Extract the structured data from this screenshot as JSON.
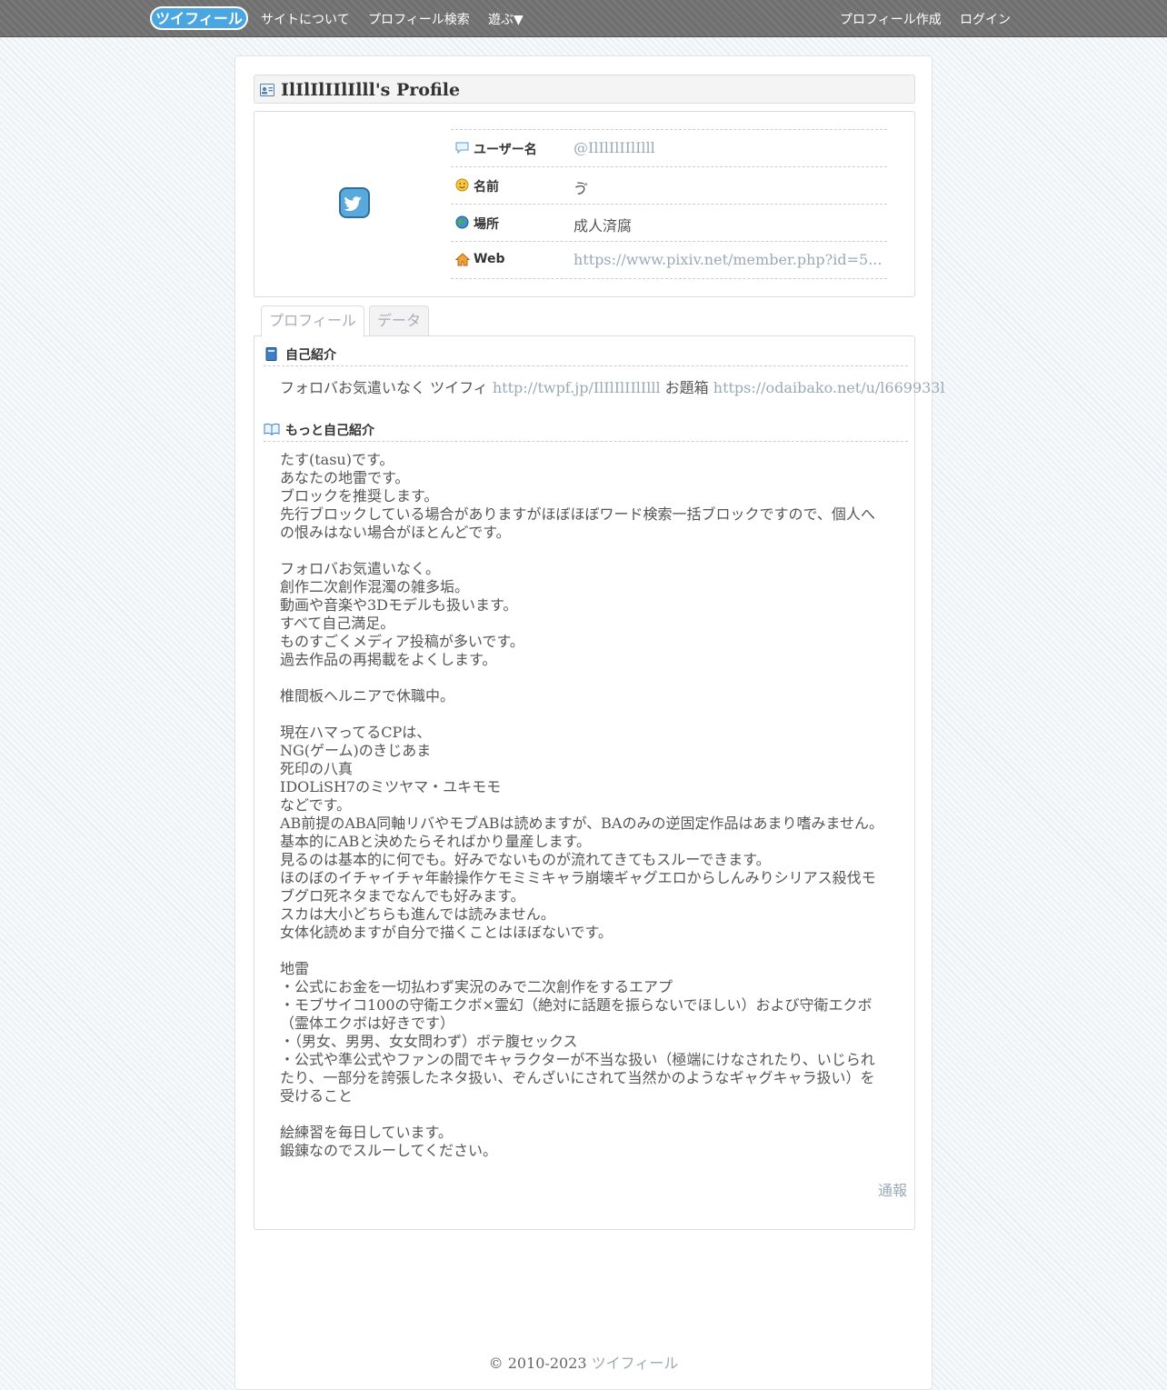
{
  "nav": {
    "logo_text": "ツイフィール",
    "about": "サイトについて",
    "search": "プロフィール検索",
    "play": "遊ぶ▼",
    "create": "プロフィール作成",
    "login": "ログイン"
  },
  "profile": {
    "title": "IlIlIlIIlIlll's Profile",
    "rows": [
      {
        "label": "ユーザー名",
        "value": "@IlIlIlIIlIlll",
        "icon": "speech-bubble-icon"
      },
      {
        "label": "名前",
        "value": "ゔ",
        "icon": "smiley-icon"
      },
      {
        "label": "場所",
        "value": "成人済腐",
        "icon": "globe-icon"
      },
      {
        "label": "Web",
        "value": "https://www.pixiv.net/member.php?id=5...",
        "icon": "home-icon"
      }
    ]
  },
  "tabs": {
    "profile": "プロフィール",
    "data": "データ"
  },
  "intro": {
    "heading": "自己紹介",
    "text1": "フォロバお気遣いなく ツイフィ ",
    "link1": "http://twpf.jp/IlIlIlIIlIlll",
    "text2": " お題箱 ",
    "link2": "https://odaibako.net/u/l669933l"
  },
  "more": {
    "heading": "もっと自己紹介",
    "lines": [
      "たす(tasu)です。",
      "あなたの地雷です。",
      "ブロックを推奨します。",
      "先行ブロックしている場合がありますがほぼほぼワード検索一括ブロックですので、個人へ",
      "の恨みはない場合がほとんどです。",
      "",
      "フォロバお気遣いなく。",
      "創作二次創作混濁の雑多垢。",
      "動画や音楽や3Dモデルも扱います。",
      "すべて自己満足。",
      "ものすごくメディア投稿が多いです。",
      "過去作品の再掲載をよくします。",
      "",
      "椎間板ヘルニアで休職中。",
      "",
      "現在ハマってるCPは、",
      "NG(ゲーム)のきじあま",
      "死印の八真",
      "IDOLiSH7のミツヤマ・ユキモモ",
      "などです。",
      "AB前提のABA同軸リバやモブABは読めますが、BAのみの逆固定作品はあまり嗜みません。",
      "基本的にABと決めたらそればかり量産します。",
      "見るのは基本的に何でも。好みでないものが流れてきてもスルーできます。",
      "ほのぼのイチャイチャ年齢操作ケモミミキャラ崩壊ギャグエロからしんみりシリアス殺伐モ",
      "ブグロ死ネタまでなんでも好みます。",
      "スカは大小どちらも進んでは読みません。",
      "女体化読めますが自分で描くことはほぼないです。",
      "",
      "地雷",
      "・公式にお金を一切払わず実況のみで二次創作をするエアプ",
      "・モブサイコ100の守衛エクボ×霊幻（絶対に話題を振らないでほしい）および守衛エクボ",
      "（霊体エクボは好きです）",
      "・（男女、男男、女女問わず）ボテ腹セックス",
      "・公式や準公式やファンの間でキャラクターが不当な扱い（極端にけなされたり、いじられ",
      "たり、一部分を誇張したネタ扱い、ぞんざいにされて当然かのようなギャグキャラ扱い）を",
      "受けること",
      "",
      "絵練習を毎日しています。",
      "鍛錬なのでスルーしてください。"
    ]
  },
  "report": "通報",
  "footer": {
    "copyright": "© 2010-2023 ",
    "site": "ツイフィール"
  }
}
